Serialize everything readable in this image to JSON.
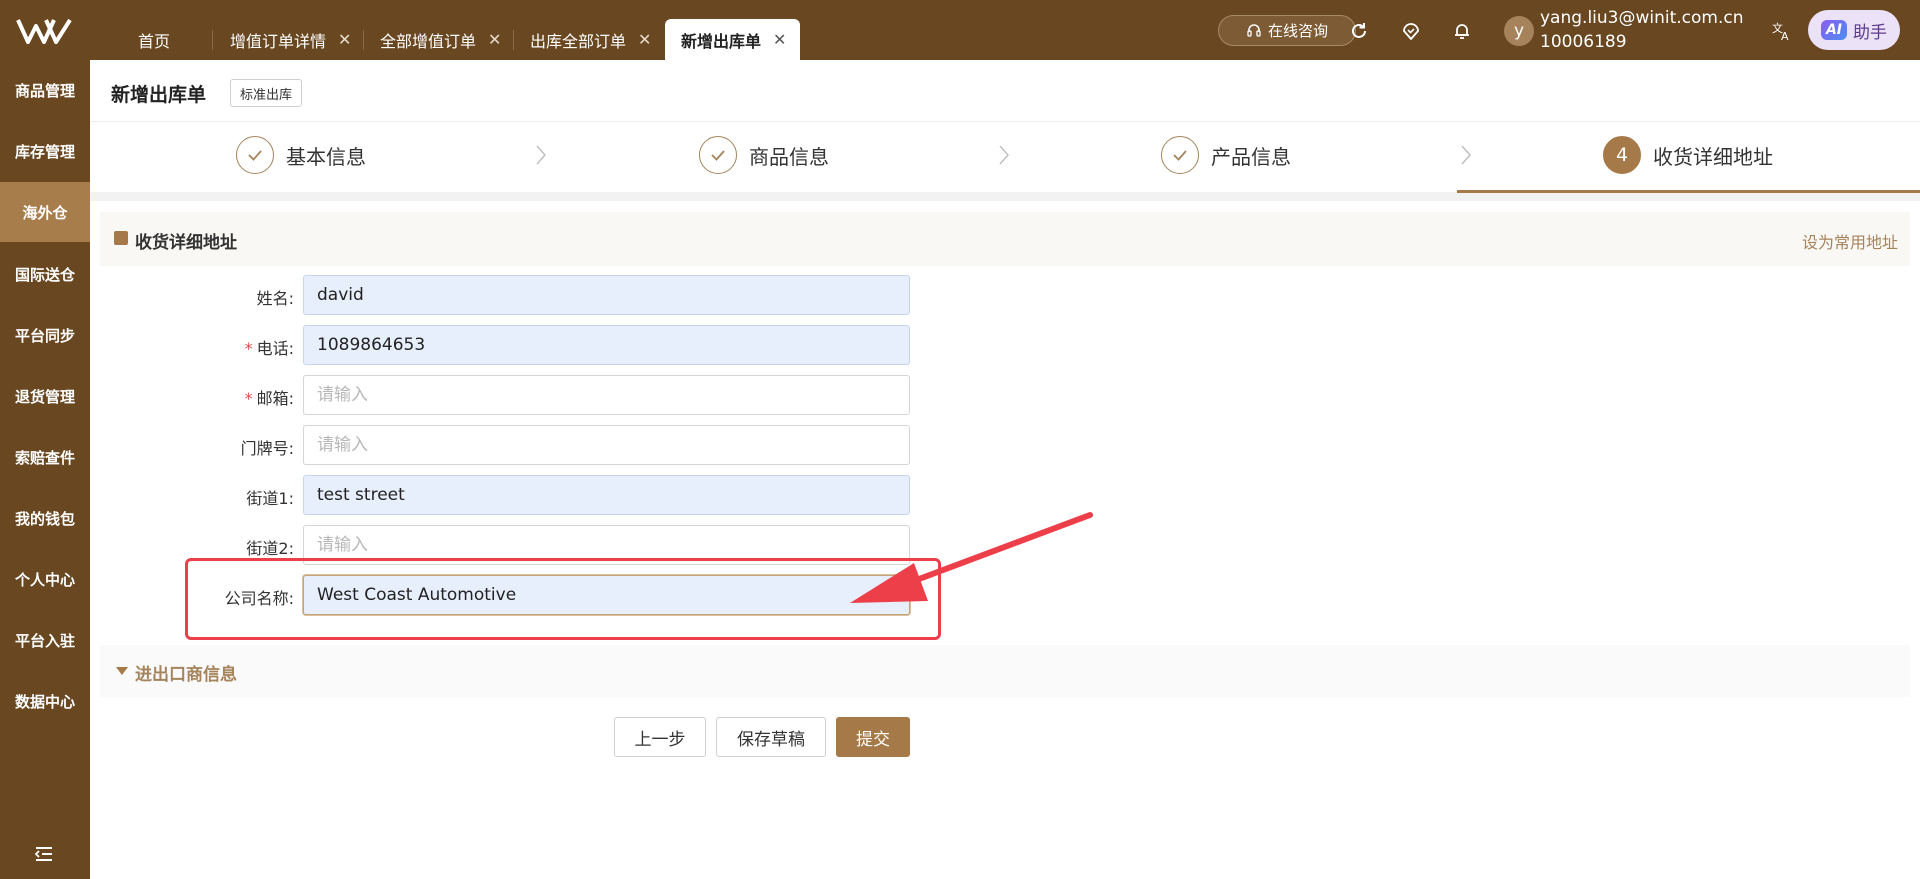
{
  "header": {
    "tabs": [
      {
        "label": "首页",
        "closable": false,
        "active": false
      },
      {
        "label": "增值订单详情",
        "closable": true,
        "active": false
      },
      {
        "label": "全部增值订单",
        "closable": true,
        "active": false
      },
      {
        "label": "出库全部订单",
        "closable": true,
        "active": false
      },
      {
        "label": "新增出库单",
        "closable": true,
        "active": true
      }
    ],
    "close_glyph": "✕",
    "consult_label": "在线咨询",
    "avatar_letter": "y",
    "user_email": "yang.liu3@winit.com.cn",
    "user_id": "10006189",
    "ai_badge": "AI",
    "ai_label": "助手"
  },
  "sidebar": {
    "items": [
      "商品管理",
      "库存管理",
      "海外仓",
      "国际送仓",
      "平台同步",
      "退货管理",
      "索赔查件",
      "我的钱包",
      "个人中心",
      "平台入驻",
      "数据中心"
    ],
    "active_index": 2
  },
  "page": {
    "title": "新增出库单",
    "tag": "标准出库"
  },
  "steps": [
    {
      "label": "基本信息",
      "status": "done"
    },
    {
      "label": "商品信息",
      "status": "done"
    },
    {
      "label": "产品信息",
      "status": "done"
    },
    {
      "label": "收货详细地址",
      "status": "active",
      "number": "4"
    }
  ],
  "address_section": {
    "title": "收货详细地址",
    "set_default_link": "设为常用地址",
    "fields": [
      {
        "label": "姓名:",
        "required": false,
        "value": "david",
        "placeholder": "请输入"
      },
      {
        "label": "电话:",
        "required": true,
        "value": "1089864653",
        "placeholder": "请输入"
      },
      {
        "label": "邮箱:",
        "required": true,
        "value": "",
        "placeholder": "请输入"
      },
      {
        "label": "门牌号:",
        "required": false,
        "value": "",
        "placeholder": "请输入"
      },
      {
        "label": "街道1:",
        "required": false,
        "value": "test street",
        "placeholder": "请输入"
      },
      {
        "label": "街道2:",
        "required": false,
        "value": "",
        "placeholder": "请输入"
      },
      {
        "label": "公司名称:",
        "required": false,
        "value": "West Coast Automotive",
        "placeholder": "请输入"
      }
    ]
  },
  "importer_section": {
    "title": "进出口商信息"
  },
  "actions": {
    "prev": "上一步",
    "save_draft": "保存草稿",
    "submit": "提交"
  },
  "colors": {
    "brand_dark": "#694720",
    "brand_accent": "#a57a48",
    "annotation_red": "#ed3f49"
  },
  "icons": {
    "logo": "winit-logo",
    "consult": "headset-icon",
    "refresh": "refresh-icon",
    "location": "location-icon",
    "bell": "bell-icon",
    "translate": "translate-icon",
    "check": "check-icon",
    "step_arrow": "chevron-right-icon",
    "collapse_sidebar": "menu-collapse-icon"
  }
}
